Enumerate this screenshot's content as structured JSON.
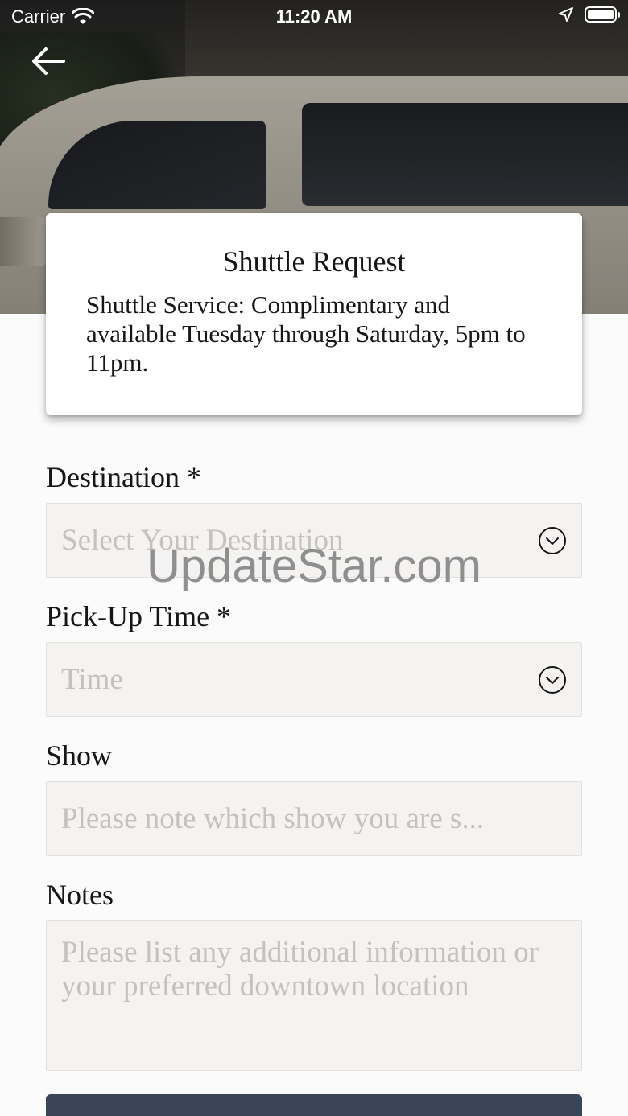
{
  "status_bar": {
    "carrier": "Carrier",
    "time": "11:20 AM"
  },
  "card": {
    "title": "Shuttle Request",
    "description": "Shuttle Service: Complimentary and available Tuesday through Saturday, 5pm to 11pm."
  },
  "form": {
    "destination": {
      "label": "Destination *",
      "placeholder": "Select Your Destination"
    },
    "pickup_time": {
      "label": "Pick-Up Time *",
      "placeholder": "Time"
    },
    "show": {
      "label": "Show",
      "placeholder": "Please note which show you are s..."
    },
    "notes": {
      "label": "Notes",
      "placeholder": "Please list any additional information or your preferred downtown location"
    }
  },
  "watermark": "UpdateStar.com",
  "colors": {
    "submit_button": "#3a4559",
    "field_background": "#f4f3f1",
    "placeholder": "#c4c2bd"
  }
}
